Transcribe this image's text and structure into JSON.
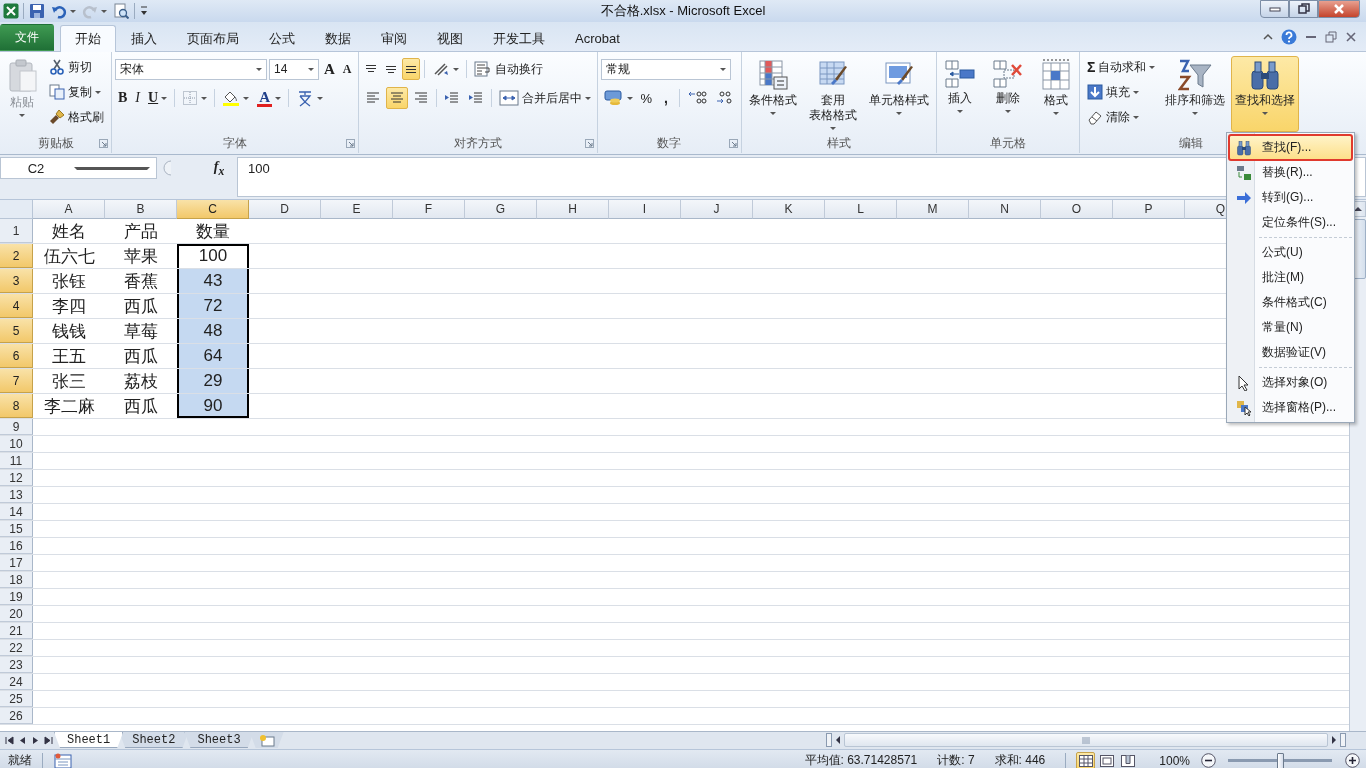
{
  "window": {
    "title": "不合格.xlsx - Microsoft Excel"
  },
  "ribbon_tabs": [
    {
      "label": "文件",
      "kind": "backstage",
      "selected": false
    },
    {
      "label": "开始",
      "kind": "tab",
      "selected": true
    },
    {
      "label": "插入",
      "kind": "tab",
      "selected": false
    },
    {
      "label": "页面布局",
      "kind": "tab",
      "selected": false
    },
    {
      "label": "公式",
      "kind": "tab",
      "selected": false
    },
    {
      "label": "数据",
      "kind": "tab",
      "selected": false
    },
    {
      "label": "审阅",
      "kind": "tab",
      "selected": false
    },
    {
      "label": "视图",
      "kind": "tab",
      "selected": false
    },
    {
      "label": "开发工具",
      "kind": "tab",
      "selected": false
    },
    {
      "label": "Acrobat",
      "kind": "tab",
      "selected": false
    }
  ],
  "clipboard": {
    "label": "剪贴板",
    "paste": {
      "label": "粘贴",
      "disabled": true
    },
    "cut": "剪切",
    "copy": "复制",
    "format_painter": "格式刷"
  },
  "font": {
    "label": "字体",
    "font_name": "宋体",
    "font_size": "14",
    "grow": "A",
    "shrink": "A",
    "bold": "B",
    "italic": "I",
    "underline": "U",
    "font_color": "A"
  },
  "alignment": {
    "label": "对齐方式",
    "vertical_align": [
      {
        "selected": false
      },
      {
        "selected": false
      },
      {
        "selected": true
      }
    ],
    "horizontal_align": [
      {
        "selected": false
      },
      {
        "selected": true
      },
      {
        "selected": false
      }
    ],
    "wrap": "自动换行",
    "merge": "合并后居中"
  },
  "number": {
    "label": "数字",
    "format": "常规",
    "percent": "%",
    "comma": ","
  },
  "styles": {
    "label": "样式",
    "conditional": "条件格式",
    "format_as_table": [
      "套用",
      "表格格式"
    ],
    "cell_styles": "单元格样式"
  },
  "cells": {
    "label": "单元格",
    "insert": "插入",
    "delete": "删除",
    "format": "格式"
  },
  "editing": {
    "label": "编辑",
    "sigma": "Σ",
    "autosum": "自动求和",
    "fill": "填充",
    "clear": "清除",
    "sort": "排序和筛选",
    "find": "查找和选择"
  },
  "formula_bar": {
    "name_box": "C2",
    "function_label": "f$_{x}$",
    "value": "100"
  },
  "sheet": {
    "columns": [
      {
        "label": "A",
        "selected": false
      },
      {
        "label": "B",
        "selected": false
      },
      {
        "label": "C",
        "selected": true
      },
      {
        "label": "D",
        "selected": false
      },
      {
        "label": "E",
        "selected": false
      },
      {
        "label": "F",
        "selected": false
      },
      {
        "label": "G",
        "selected": false
      },
      {
        "label": "H",
        "selected": false
      },
      {
        "label": "I",
        "selected": false
      },
      {
        "label": "J",
        "selected": false
      },
      {
        "label": "K",
        "selected": false
      },
      {
        "label": "L",
        "selected": false
      },
      {
        "label": "M",
        "selected": false
      },
      {
        "label": "N",
        "selected": false
      },
      {
        "label": "O",
        "selected": false
      },
      {
        "label": "P",
        "selected": false
      },
      {
        "label": "Q",
        "selected": false
      }
    ],
    "rows": [
      {
        "number": "1",
        "selected": false,
        "cells": [
          {
            "text": "姓名",
            "selected": false,
            "active": false
          },
          {
            "text": "产品",
            "selected": false,
            "active": false
          },
          {
            "text": "数量",
            "selected": false,
            "active": false
          }
        ]
      },
      {
        "number": "2",
        "selected": true,
        "cells": [
          {
            "text": "伍六七",
            "selected": false,
            "active": false
          },
          {
            "text": "苹果",
            "selected": false,
            "active": false
          },
          {
            "text": "100",
            "selected": true,
            "active": true
          }
        ]
      },
      {
        "number": "3",
        "selected": true,
        "cells": [
          {
            "text": "张钰",
            "selected": false,
            "active": false
          },
          {
            "text": "香蕉",
            "selected": false,
            "active": false
          },
          {
            "text": "43",
            "selected": true,
            "active": false
          }
        ]
      },
      {
        "number": "4",
        "selected": true,
        "cells": [
          {
            "text": "李四",
            "selected": false,
            "active": false
          },
          {
            "text": "西瓜",
            "selected": false,
            "active": false
          },
          {
            "text": "72",
            "selected": true,
            "active": false
          }
        ]
      },
      {
        "number": "5",
        "selected": true,
        "cells": [
          {
            "text": "钱钱",
            "selected": false,
            "active": false
          },
          {
            "text": "草莓",
            "selected": false,
            "active": false
          },
          {
            "text": "48",
            "selected": true,
            "active": false
          }
        ]
      },
      {
        "number": "6",
        "selected": true,
        "cells": [
          {
            "text": "王五",
            "selected": false,
            "active": false
          },
          {
            "text": "西瓜",
            "selected": false,
            "active": false
          },
          {
            "text": "64",
            "selected": true,
            "active": false
          }
        ]
      },
      {
        "number": "7",
        "selected": true,
        "cells": [
          {
            "text": "张三",
            "selected": false,
            "active": false
          },
          {
            "text": "荔枝",
            "selected": false,
            "active": false
          },
          {
            "text": "29",
            "selected": true,
            "active": false
          }
        ]
      },
      {
        "number": "8",
        "selected": true,
        "cells": [
          {
            "text": "李二麻",
            "selected": false,
            "active": false
          },
          {
            "text": "西瓜",
            "selected": false,
            "active": false
          },
          {
            "text": "90",
            "selected": true,
            "active": false
          }
        ]
      },
      {
        "number": "9",
        "selected": false
      },
      {
        "number": "10",
        "selected": false
      },
      {
        "number": "11",
        "selected": false
      },
      {
        "number": "12",
        "selected": false
      },
      {
        "number": "13",
        "selected": false
      },
      {
        "number": "14",
        "selected": false
      },
      {
        "number": "15",
        "selected": false
      },
      {
        "number": "16",
        "selected": false
      },
      {
        "number": "17",
        "selected": false
      },
      {
        "number": "18",
        "selected": false
      },
      {
        "number": "19",
        "selected": false
      },
      {
        "number": "20",
        "selected": false
      },
      {
        "number": "21",
        "selected": false
      },
      {
        "number": "22",
        "selected": false
      },
      {
        "number": "23",
        "selected": false
      },
      {
        "number": "24",
        "selected": false
      },
      {
        "number": "25",
        "selected": false
      },
      {
        "number": "26",
        "selected": false
      }
    ]
  },
  "find_menu": {
    "open": true,
    "sections": [
      {
        "items": [
          {
            "label": "查找(F)...",
            "kind": "find",
            "highlighted": true,
            "annotated": true
          },
          {
            "label": "替换(R)...",
            "kind": "replace",
            "highlighted": false,
            "annotated": false
          },
          {
            "label": "转到(G)...",
            "kind": "goto",
            "highlighted": false,
            "annotated": false
          },
          {
            "label": "定位条件(S)...",
            "kind": "plain",
            "highlighted": false,
            "annotated": false
          }
        ]
      },
      {
        "items": [
          {
            "label": "公式(U)",
            "kind": "plain",
            "highlighted": false,
            "annotated": false
          },
          {
            "label": "批注(M)",
            "kind": "plain",
            "highlighted": false,
            "annotated": false
          },
          {
            "label": "条件格式(C)",
            "kind": "plain",
            "highlighted": false,
            "annotated": false
          },
          {
            "label": "常量(N)",
            "kind": "plain",
            "highlighted": false,
            "annotated": false
          },
          {
            "label": "数据验证(V)",
            "kind": "plain",
            "highlighted": false,
            "annotated": false
          }
        ]
      },
      {
        "items": [
          {
            "label": "选择对象(O)",
            "kind": "pointer",
            "highlighted": false,
            "annotated": false
          },
          {
            "label": "选择窗格(P)...",
            "kind": "pane",
            "highlighted": false,
            "annotated": false
          }
        ]
      }
    ]
  },
  "sheet_tabs": [
    {
      "label": "Sheet1",
      "selected": true
    },
    {
      "label": "Sheet2",
      "selected": false
    },
    {
      "label": "Sheet3",
      "selected": false
    }
  ],
  "status_bar": {
    "mode": "就绪",
    "average": "平均值: 63.71428571",
    "count": "计数: 7",
    "sum": "求和: 446",
    "views": [
      {
        "selected": true
      },
      {
        "selected": false
      },
      {
        "selected": false
      }
    ],
    "zoom": "100%",
    "zoom_slider": {
      "level": 0.5
    }
  }
}
